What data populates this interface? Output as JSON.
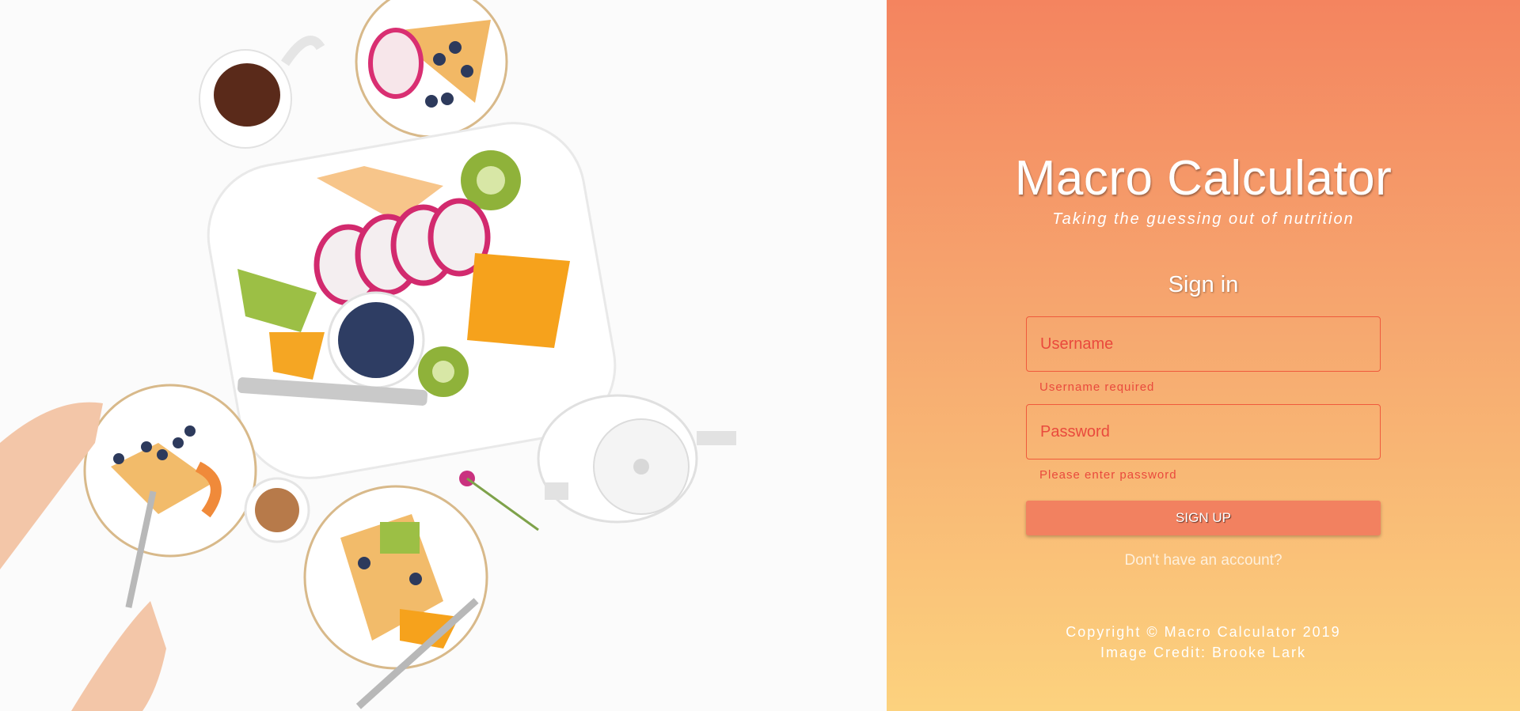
{
  "app": {
    "title": "Macro Calculator",
    "tagline": "Taking the guessing out of nutrition"
  },
  "form": {
    "heading": "Sign in",
    "username": {
      "placeholder": "Username",
      "value": "",
      "error": "Username required"
    },
    "password": {
      "placeholder": "Password",
      "value": "",
      "error": "Please enter password"
    },
    "submit_label": "SIGN UP",
    "account_link": "Don't have an account?"
  },
  "footer": {
    "copyright": "Copyright © Macro Calculator 2019",
    "credit": "Image Credit: Brooke Lark"
  },
  "colors": {
    "gradient_top": "#f4845f",
    "gradient_bottom": "#fcd27e",
    "error": "#e94a3d",
    "button": "#f28160"
  }
}
